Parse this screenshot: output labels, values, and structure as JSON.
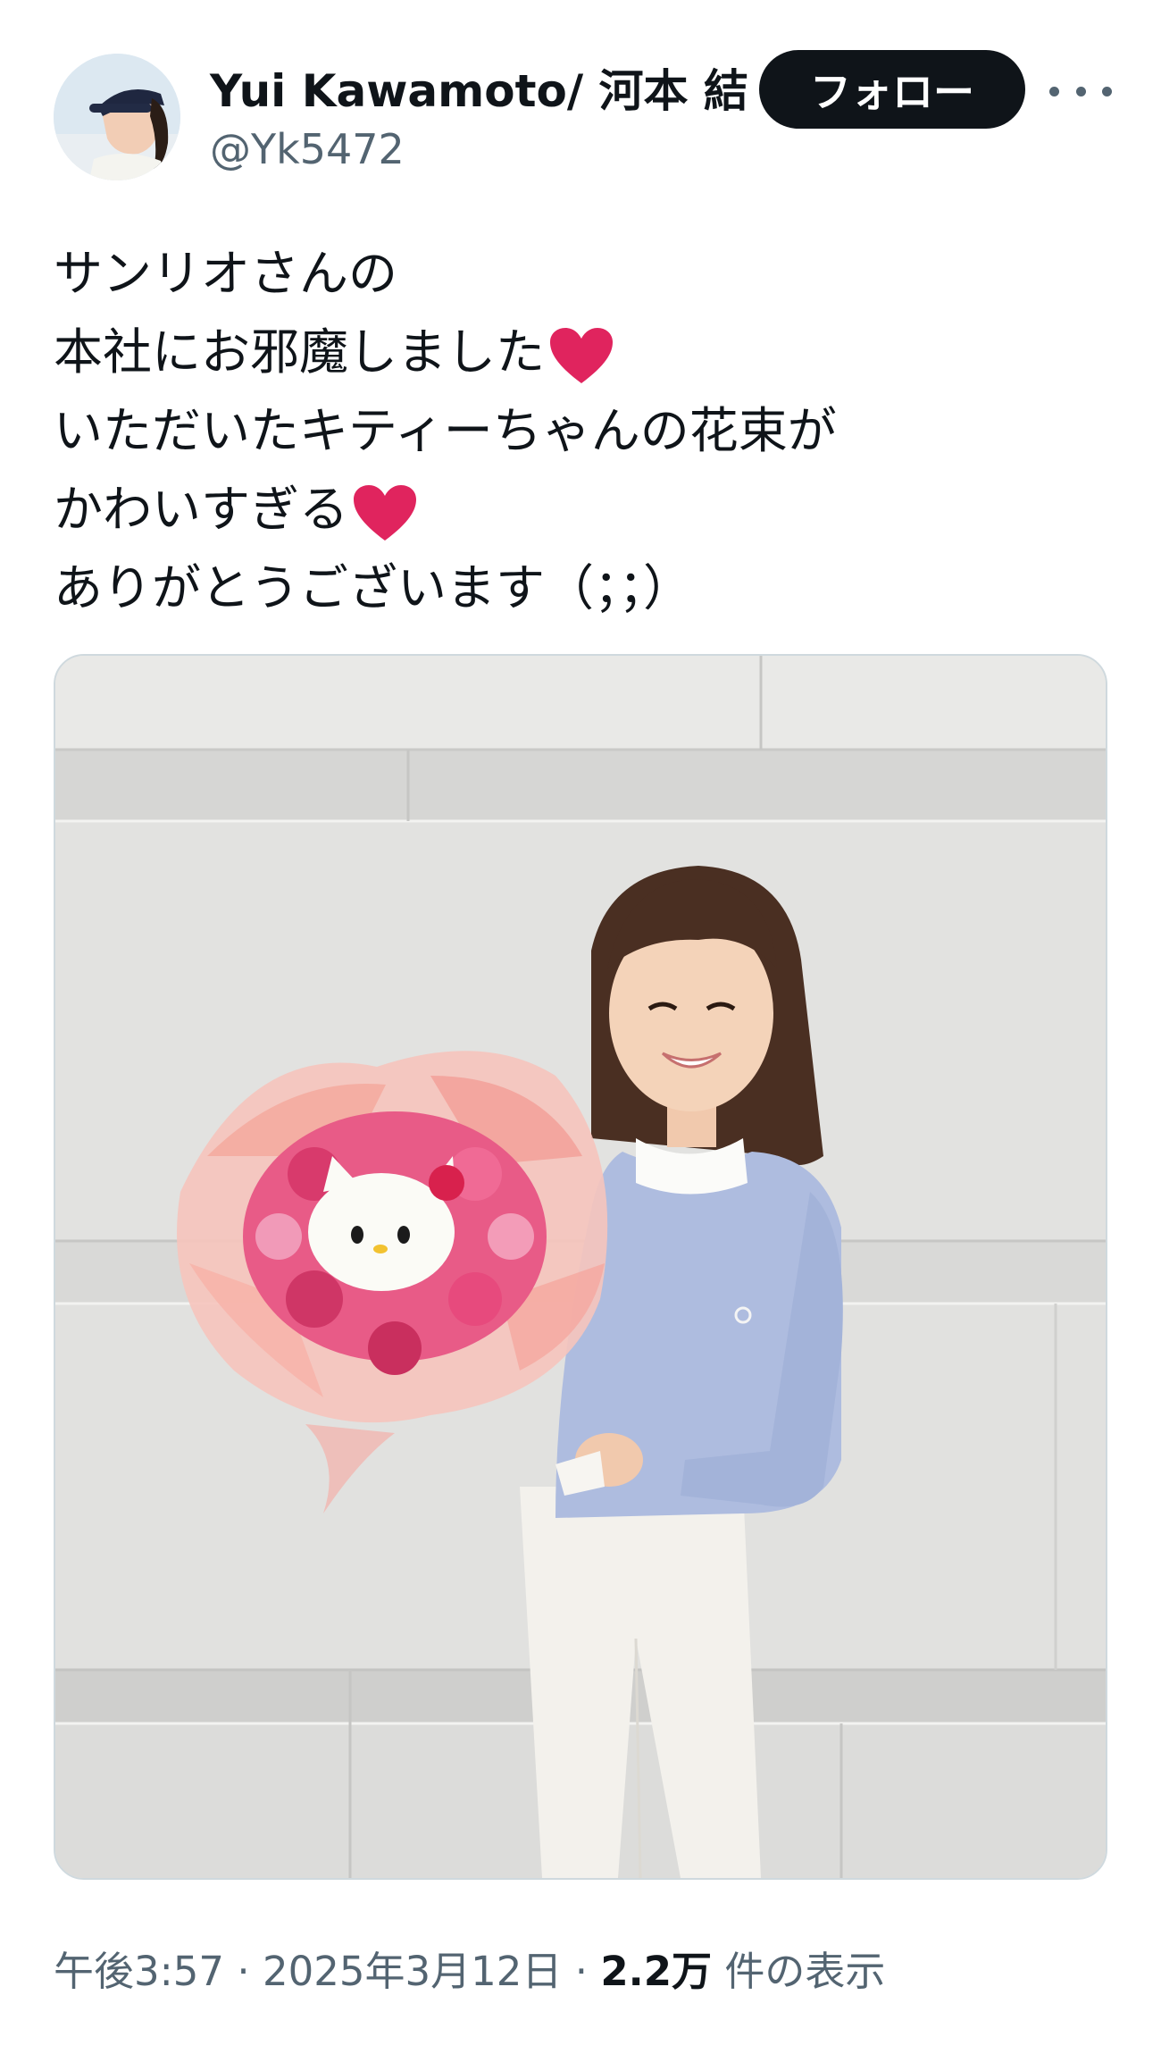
{
  "author": {
    "name": "Yui Kawamoto/ 河本 結",
    "handle": "@Yk5472",
    "avatar_icon": "profile-photo"
  },
  "follow_label": "フォロー",
  "more_icon": "more-horizontal-icon",
  "tweet": {
    "lines": [
      {
        "text": "サンリオさんの",
        "emoji": ""
      },
      {
        "text": "本社にお邪魔しました",
        "emoji": "red-heart"
      },
      {
        "text": "いただいたキティーちゃんの花束が",
        "emoji": ""
      },
      {
        "text": "かわいすぎる",
        "emoji": "red-heart"
      },
      {
        "text": "ありがとうございます（；；）",
        "emoji": ""
      }
    ]
  },
  "media": {
    "type": "photo"
  },
  "meta": {
    "time": "午後3:57",
    "separator": " · ",
    "date": "2025年3月12日",
    "views": "2.2万",
    "views_suffix": " 件の表示"
  },
  "colors": {
    "text": "#0f1419",
    "secondary": "#536471",
    "heart": "#e0245e",
    "follow_bg": "#0f1419"
  }
}
